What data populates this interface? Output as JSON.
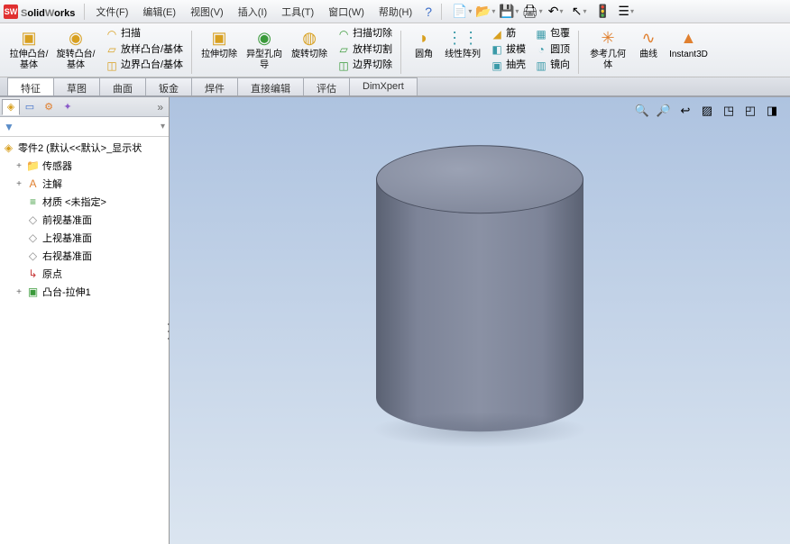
{
  "brand": {
    "prefix": "S",
    "rest": "olid",
    "second": "W",
    "rest2": "orks"
  },
  "menus": [
    {
      "label": "文件(F)"
    },
    {
      "label": "编辑(E)"
    },
    {
      "label": "视图(V)"
    },
    {
      "label": "插入(I)"
    },
    {
      "label": "工具(T)"
    },
    {
      "label": "窗口(W)"
    },
    {
      "label": "帮助(H)"
    }
  ],
  "ribbon": {
    "g1": [
      {
        "label": "拉伸凸台/基体",
        "icon": "▣",
        "large": true,
        "color": "c-yellow"
      },
      {
        "label": "旋转凸台/基体",
        "icon": "◉",
        "large": true,
        "color": "c-yellow"
      }
    ],
    "g1b": [
      {
        "label": "扫描",
        "icon": "◠",
        "color": "c-yellow"
      },
      {
        "label": "放样凸台/基体",
        "icon": "▱",
        "color": "c-yellow"
      },
      {
        "label": "边界凸台/基体",
        "icon": "◫",
        "color": "c-yellow"
      }
    ],
    "g2": [
      {
        "label": "拉伸切除",
        "icon": "▣",
        "large": true,
        "color": "c-yellow"
      },
      {
        "label": "异型孔向导",
        "icon": "◉",
        "large": true,
        "color": "c-green"
      },
      {
        "label": "旋转切除",
        "icon": "◍",
        "large": true,
        "color": "c-yellow"
      }
    ],
    "g2b": [
      {
        "label": "扫描切除",
        "icon": "◠",
        "color": "c-green"
      },
      {
        "label": "放样切割",
        "icon": "▱",
        "color": "c-green"
      },
      {
        "label": "边界切除",
        "icon": "◫",
        "color": "c-green"
      }
    ],
    "g3": [
      {
        "label": "圆角",
        "icon": "◗",
        "large": true,
        "color": "c-yellow"
      },
      {
        "label": "线性阵列",
        "icon": "⋮⋮",
        "large": true,
        "color": "c-teal"
      }
    ],
    "g3b": [
      {
        "label": "筋",
        "icon": "◢",
        "color": "c-yellow"
      },
      {
        "label": "拔模",
        "icon": "◧",
        "color": "c-teal"
      },
      {
        "label": "抽壳",
        "icon": "▣",
        "color": "c-teal"
      }
    ],
    "g3c": [
      {
        "label": "包覆",
        "icon": "▦",
        "color": "c-teal"
      },
      {
        "label": "圆顶",
        "icon": "◔",
        "color": "c-teal"
      },
      {
        "label": "镜向",
        "icon": "▥",
        "color": "c-teal"
      }
    ],
    "g4": [
      {
        "label": "参考几何体",
        "icon": "✳",
        "large": true,
        "color": "c-orange"
      },
      {
        "label": "曲线",
        "icon": "∿",
        "large": true,
        "color": "c-orange"
      },
      {
        "label": "Instant3D",
        "icon": "▲",
        "large": true,
        "color": "c-orange"
      }
    ]
  },
  "tabs": [
    {
      "label": "特征",
      "active": true
    },
    {
      "label": "草图"
    },
    {
      "label": "曲面"
    },
    {
      "label": "钣金"
    },
    {
      "label": "焊件"
    },
    {
      "label": "直接编辑"
    },
    {
      "label": "评估"
    },
    {
      "label": "DimXpert"
    }
  ],
  "tree": {
    "root": "零件2  (默认<<默认>_显示状",
    "items": [
      {
        "icon": "📁",
        "label": "传感器",
        "color": "c-yellow",
        "expander": "+"
      },
      {
        "icon": "A",
        "label": "注解",
        "color": "c-orange",
        "expander": "+"
      },
      {
        "icon": "≡",
        "label": "材质 <未指定>",
        "color": "c-green",
        "expander": ""
      },
      {
        "icon": "◇",
        "label": "前视基准面",
        "color": "c-gray",
        "expander": ""
      },
      {
        "icon": "◇",
        "label": "上视基准面",
        "color": "c-gray",
        "expander": ""
      },
      {
        "icon": "◇",
        "label": "右视基准面",
        "color": "c-gray",
        "expander": ""
      },
      {
        "icon": "↳",
        "label": "原点",
        "color": "c-red",
        "expander": ""
      },
      {
        "icon": "▣",
        "label": "凸台-拉伸1",
        "color": "c-green",
        "expander": "+"
      }
    ]
  },
  "quickIcons": [
    {
      "name": "new-doc-icon",
      "glyph": "📄",
      "dd": true
    },
    {
      "name": "open-icon",
      "glyph": "📂",
      "dd": true
    },
    {
      "name": "save-icon",
      "glyph": "💾",
      "dd": true
    },
    {
      "name": "print-icon",
      "glyph": "🖨",
      "dd": true
    },
    {
      "name": "undo-icon",
      "glyph": "↶",
      "dd": true
    },
    {
      "name": "select-icon",
      "glyph": "↖",
      "dd": true
    },
    {
      "name": "rebuild-icon",
      "glyph": "🚦",
      "dd": false
    },
    {
      "name": "options-icon",
      "glyph": "☰",
      "dd": true
    }
  ],
  "viewTools": [
    {
      "name": "zoom-fit-icon",
      "glyph": "🔍"
    },
    {
      "name": "zoom-area-icon",
      "glyph": "🔎"
    },
    {
      "name": "prev-view-icon",
      "glyph": "↩"
    },
    {
      "name": "section-icon",
      "glyph": "▨"
    },
    {
      "name": "display-icon",
      "glyph": "◳"
    },
    {
      "name": "hide-icon",
      "glyph": "◰"
    },
    {
      "name": "appearance-icon",
      "glyph": "◨"
    }
  ]
}
